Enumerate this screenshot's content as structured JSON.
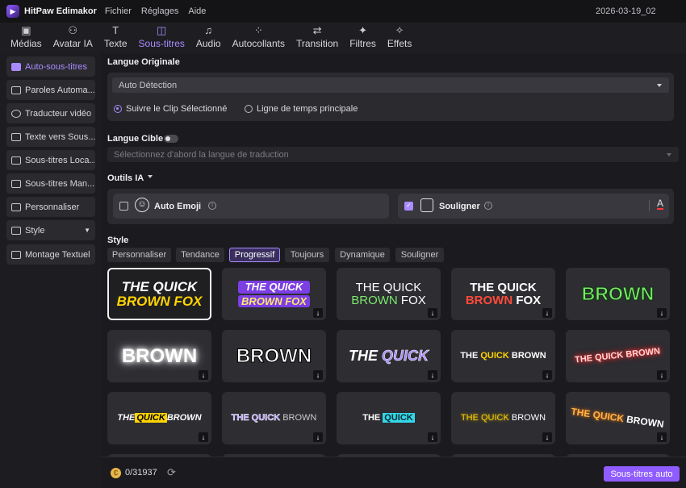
{
  "app": {
    "name": "HitPaw Edimakor",
    "project": "2026-03-19_02"
  },
  "menu": [
    "Fichier",
    "Réglages",
    "Aide"
  ],
  "toolbar": [
    {
      "label": "Médias",
      "icon": "media-icon",
      "glyph": "▣"
    },
    {
      "label": "Avatar IA",
      "icon": "avatar-ia-icon",
      "glyph": "⚇"
    },
    {
      "label": "Texte",
      "icon": "text-icon",
      "glyph": "T"
    },
    {
      "label": "Sous-titres",
      "icon": "subtitles-icon",
      "glyph": "◫",
      "active": true
    },
    {
      "label": "Audio",
      "icon": "audio-icon",
      "glyph": "♫"
    },
    {
      "label": "Autocollants",
      "icon": "stickers-icon",
      "glyph": "⁘"
    },
    {
      "label": "Transition",
      "icon": "transition-icon",
      "glyph": "⇄"
    },
    {
      "label": "Filtres",
      "icon": "filters-icon",
      "glyph": "✦"
    },
    {
      "label": "Effets",
      "icon": "effects-icon",
      "glyph": "✧"
    }
  ],
  "sidebar": [
    {
      "label": "Auto-sous-titres",
      "active": true
    },
    {
      "label": "Paroles Automa..."
    },
    {
      "label": "Traducteur vidéo"
    },
    {
      "label": "Texte vers Sous..."
    },
    {
      "label": "Sous-titres Loca..."
    },
    {
      "label": "Sous-titres Man..."
    },
    {
      "label": "Personnaliser"
    },
    {
      "label": "Style",
      "dropdown": true
    },
    {
      "label": "Montage Textuel"
    }
  ],
  "original": {
    "heading": "Langue Originale",
    "value": "Auto Détection",
    "radio1": "Suivre le Clip Sélectionné",
    "radio2": "Ligne de temps principale"
  },
  "target": {
    "heading": "Langue Cible",
    "placeholder": "Sélectionnez d'abord la langue de traduction"
  },
  "tools": {
    "heading": "Outils IA",
    "emoji": "Auto Emoji",
    "underline": "Souligner",
    "underline_letter": "A",
    "info": "i",
    "check": "✓"
  },
  "style": {
    "heading": "Style",
    "tabs": [
      "Personnaliser",
      "Tendance",
      "Progressif",
      "Toujours",
      "Dynamique",
      "Souligner"
    ],
    "active_tab": "Progressif"
  },
  "cards": [
    {
      "l1": "THE QUICK",
      "l2": "BROWN FOX"
    },
    {
      "l1": "THE QUICK",
      "l2": "BROWN FOX"
    },
    {
      "l1": "THE QUICK",
      "l2a": "BROWN",
      "l2b": "FOX"
    },
    {
      "l1": "THE QUICK",
      "l2a": "BROWN",
      "l2b": "FOX"
    },
    {
      "l1": "BROWN"
    },
    {
      "l1": "BROWN"
    },
    {
      "l1": "BROWN"
    },
    {
      "a": "THE",
      "b": "QUICK"
    },
    {
      "a": "THE",
      "b": "QUICK",
      "c": "BROWN"
    },
    {
      "l1": "THE QUICK BROWN"
    },
    {
      "a": "THE",
      "b": "QUICK",
      "c": "BROWN"
    },
    {
      "a": "THE QUICK",
      "c": "BROWN"
    },
    {
      "a": "THE",
      "b": "QUICK"
    },
    {
      "a": "THE QUICK",
      "c": "BROWN"
    },
    {
      "a": "THE QUICK",
      "c": "BROWN"
    }
  ],
  "download_glyph": "↓",
  "bottom": {
    "credits": "0/31937",
    "button": "Sous-titres auto",
    "coin": "₵",
    "refresh": "⟳"
  },
  "colors": {
    "accent": "#a98bff",
    "button": "#8f5cff",
    "green": "#7be86b",
    "red": "#ff4b3a",
    "yellow": "#ffd400",
    "cyan": "#35d6e8"
  }
}
